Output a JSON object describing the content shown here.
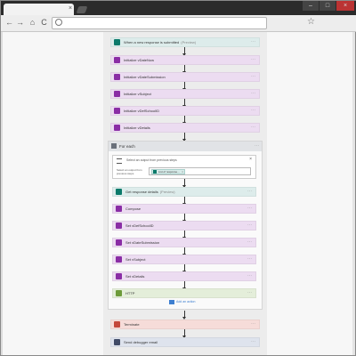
{
  "browser": {
    "tab_close": "×",
    "window_controls": {
      "minimize": "–",
      "maximize": "□",
      "close": "×"
    },
    "nav": {
      "back": "←",
      "forward": "→",
      "home": "⌂",
      "reload": "C",
      "bookmark": "☆"
    }
  },
  "flow": {
    "trigger": {
      "label": "When a new response is submitted",
      "tag": "(Preview)",
      "icon": "forms-icon"
    },
    "top_actions": [
      {
        "label": "Initialize vDateNow",
        "icon": "variable-icon"
      },
      {
        "label": "Initialize vDateSubmission",
        "icon": "variable-icon"
      },
      {
        "label": "Initialize vSubject",
        "icon": "variable-icon"
      },
      {
        "label": "Initialize vDefSchoolID",
        "icon": "variable-icon"
      },
      {
        "label": "Initialize vDetails",
        "icon": "variable-icon"
      }
    ],
    "foreach": {
      "label": "For each",
      "select_title": "Select an output from previous steps",
      "select_label": "Select an output from previous steps",
      "token_label": "List of response...",
      "token_remove": "×",
      "actions": [
        {
          "label": "Get response details",
          "tag": "(Preview)",
          "kind": "forms"
        },
        {
          "label": "Compose",
          "tag": "",
          "kind": "var"
        },
        {
          "label": "Set vDefSchoolID",
          "tag": "",
          "kind": "var"
        },
        {
          "label": "Set vDateSubmission",
          "tag": "",
          "kind": "var"
        },
        {
          "label": "Set vSubject",
          "tag": "",
          "kind": "var"
        },
        {
          "label": "Set vDetails",
          "tag": "",
          "kind": "var"
        },
        {
          "label": "HTTP",
          "tag": "",
          "kind": "http"
        }
      ],
      "add_action": "Add an action"
    },
    "bottom_actions": [
      {
        "label": "Terminate",
        "kind": "term"
      },
      {
        "label": "Send debugger email",
        "kind": "mail"
      }
    ],
    "more": "···",
    "colors": {
      "forms": "#0b7a6a",
      "variable": "#8a2da5",
      "http": "#6d9b3a",
      "terminate": "#c4463a",
      "mail": "#404a66"
    }
  }
}
